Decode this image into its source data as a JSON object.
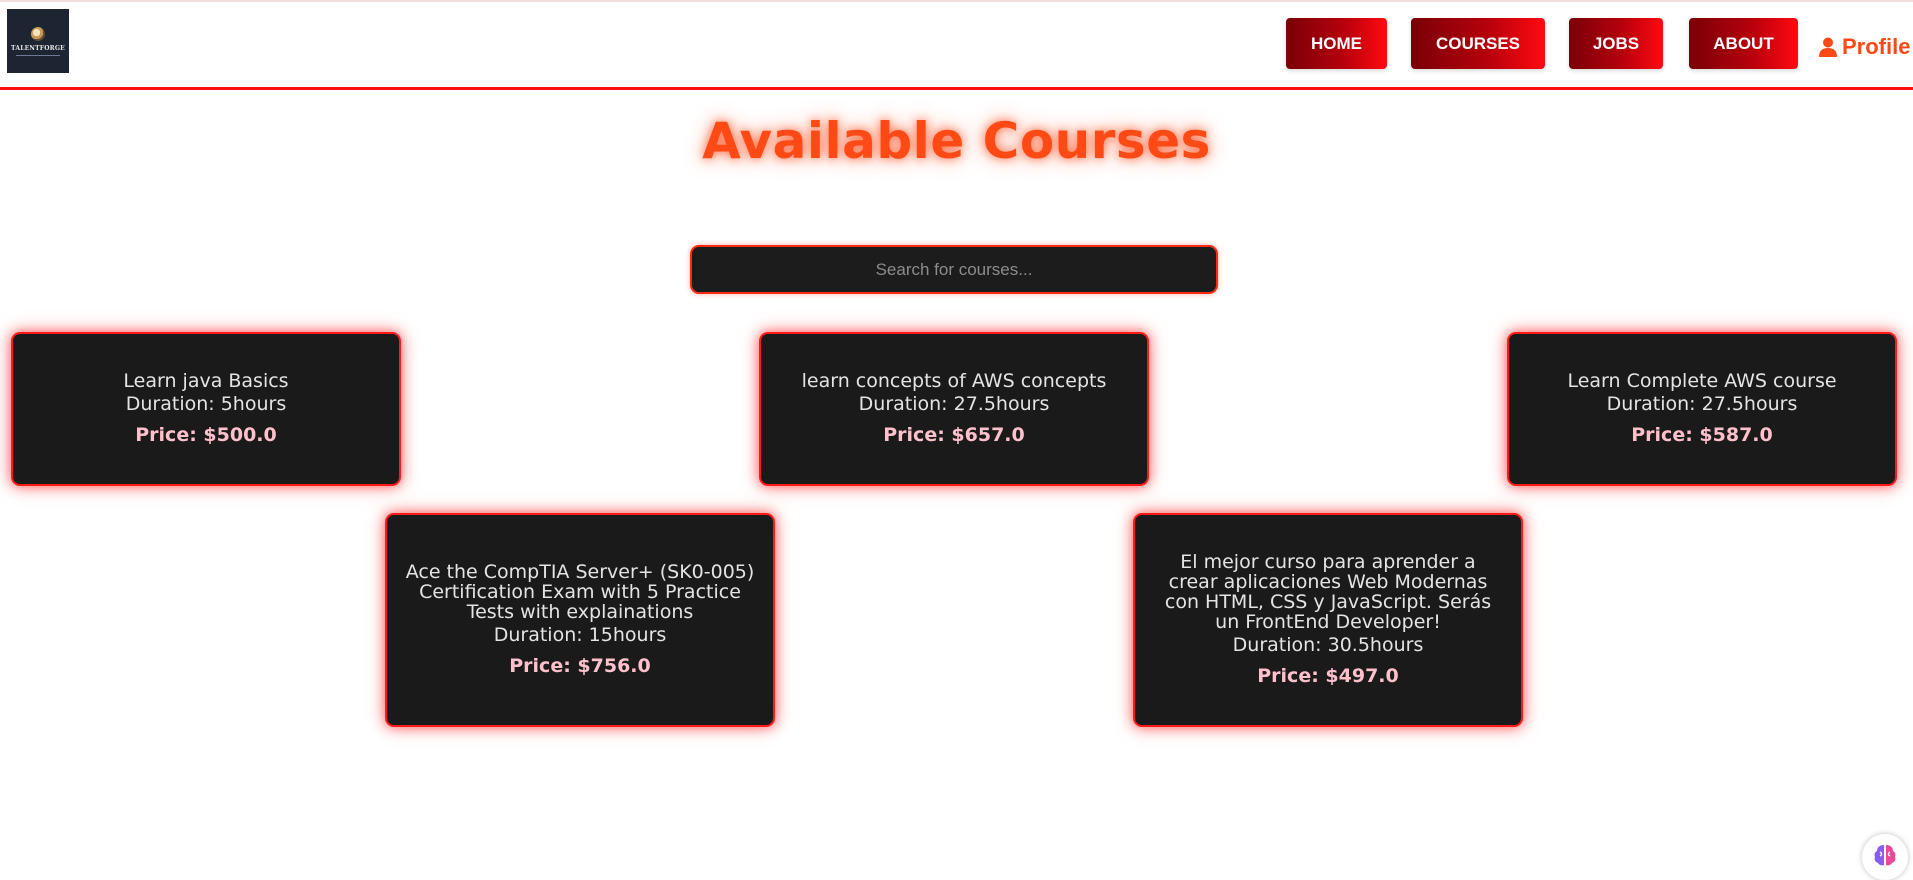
{
  "header": {
    "logo_text": "TALENTFORGE",
    "nav": [
      {
        "label": "HOME"
      },
      {
        "label": "COURSES"
      },
      {
        "label": "JOBS"
      },
      {
        "label": "ABOUT"
      }
    ],
    "profile_label": "Profile",
    "profile_icon": "user-icon"
  },
  "main": {
    "title": "Available Courses",
    "search": {
      "placeholder": "Search for courses...",
      "value": ""
    },
    "courses": [
      {
        "title": "Learn java Basics",
        "duration": "Duration: 5hours",
        "price": "Price: $500.0"
      },
      {
        "title": "learn concepts of AWS concepts",
        "duration": "Duration: 27.5hours",
        "price": "Price: $657.0"
      },
      {
        "title": "Learn Complete AWS course",
        "duration": "Duration: 27.5hours",
        "price": "Price: $587.0"
      },
      {
        "title": "Ace the CompTIA Server+ (SK0-005) Certification Exam with 5 Practice Tests with explainations",
        "duration": "Duration: 15hours",
        "price": "Price: $756.0"
      },
      {
        "title": "El mejor curso para aprender a crear aplicaciones Web Modernas con HTML, CSS y JavaScript. Serás un FrontEnd Developer!",
        "duration": "Duration: 30.5hours",
        "price": "Price: $497.0"
      }
    ]
  },
  "colors": {
    "accent": "#ff4a16",
    "nav_gradient_start": "#7a0008",
    "nav_gradient_end": "#ff0a10",
    "card_bg": "#1a1a1a",
    "card_border": "#ff1a1a",
    "price_text": "#ffc0cb"
  },
  "widgets": {
    "assistant_icon": "brain-icon"
  }
}
